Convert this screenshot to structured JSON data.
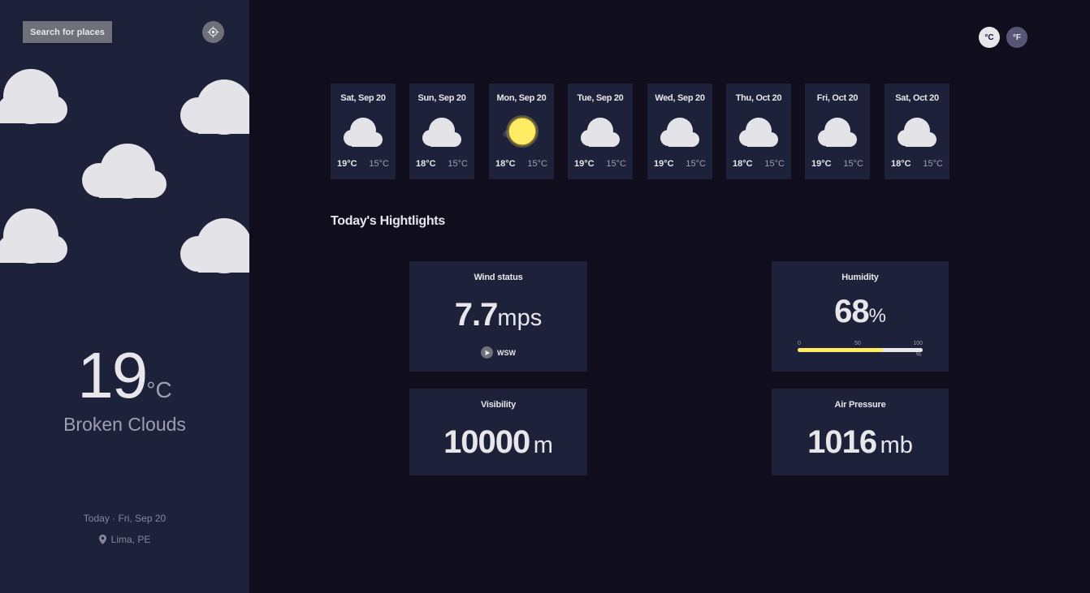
{
  "sidebar": {
    "search_label": "Search for places",
    "location_icon": "crosshair-gps-icon",
    "current_temp": "19",
    "current_unit": "°C",
    "weather_desc": "Broken Clouds",
    "date_text": "Today · Fri, Sep 20",
    "location_text": "Lima, PE",
    "location_icon_name": "map-pin-icon"
  },
  "units": {
    "celsius": "°C",
    "fahrenheit": "°F",
    "active": "celsius"
  },
  "forecast": [
    {
      "date": "Sat, Sep 20",
      "max": "19°C",
      "min": "15°C",
      "icon": "cloud-icon"
    },
    {
      "date": "Sun, Sep 20",
      "max": "18°C",
      "min": "15°C",
      "icon": "cloud-icon"
    },
    {
      "date": "Mon, Sep 20",
      "max": "18°C",
      "min": "15°C",
      "icon": "sun-icon"
    },
    {
      "date": "Tue, Sep 20",
      "max": "19°C",
      "min": "15°C",
      "icon": "cloud-icon"
    },
    {
      "date": "Wed, Sep 20",
      "max": "19°C",
      "min": "15°C",
      "icon": "cloud-icon"
    },
    {
      "date": "Thu, Oct 20",
      "max": "18°C",
      "min": "15°C",
      "icon": "cloud-icon"
    },
    {
      "date": "Fri, Oct 20",
      "max": "19°C",
      "min": "15°C",
      "icon": "cloud-icon"
    },
    {
      "date": "Sat, Oct 20",
      "max": "18°C",
      "min": "15°C",
      "icon": "cloud-icon"
    }
  ],
  "highlights": {
    "title": "Today's Hightlights",
    "wind": {
      "label": "Wind status",
      "value": "7.7",
      "unit": "mps",
      "direction": "WSW",
      "icon": "navigation-arrow-icon"
    },
    "humidity": {
      "label": "Humidity",
      "value": "68",
      "unit": "%",
      "percent": 68,
      "tick_0": "0",
      "tick_50": "50",
      "tick_100": "100",
      "pct_sign": "%"
    },
    "visibility": {
      "label": "Visibility",
      "value": "10000",
      "unit": "m"
    },
    "pressure": {
      "label": "Air Pressure",
      "value": "1016",
      "unit": "mb"
    }
  },
  "colors": {
    "background": "#100e1d",
    "panel": "#1e213a",
    "accent_yellow": "#ffec65",
    "text_primary": "#e7e7eb",
    "text_secondary": "#a09fb1"
  }
}
